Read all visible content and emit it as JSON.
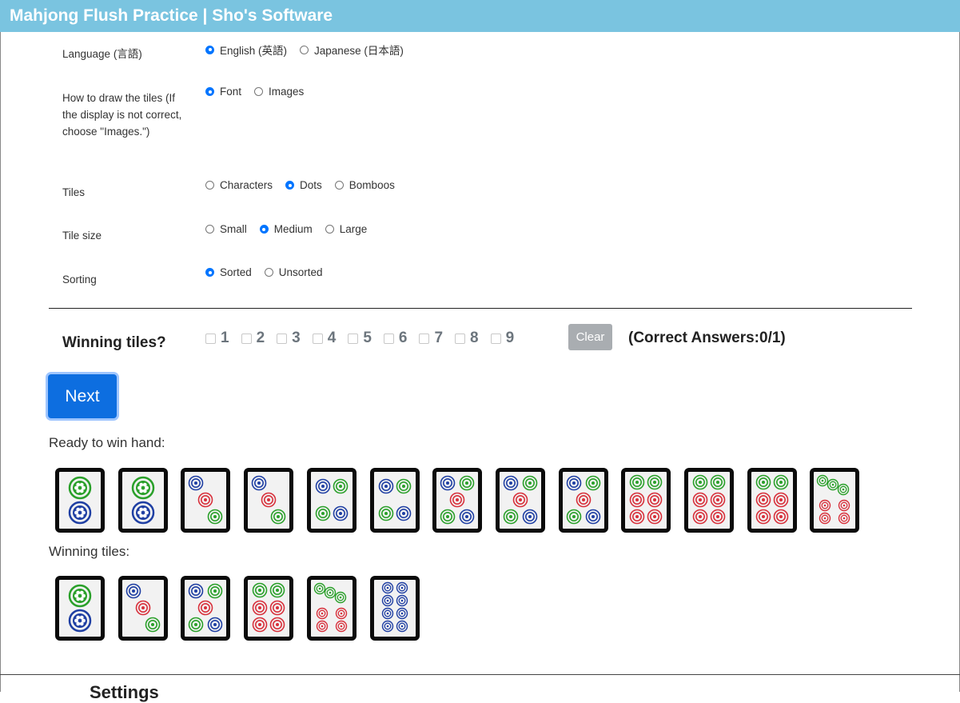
{
  "app": {
    "title": "Mahjong Flush Practice | Sho's Software"
  },
  "settings": {
    "language": {
      "label": "Language (言語)",
      "options": [
        "English (英語)",
        "Japanese (日本語)"
      ],
      "selected": 0
    },
    "draw": {
      "label": "How to draw the tiles (If the display is not correct, choose \"Images.\")",
      "options": [
        "Font",
        "Images"
      ],
      "selected": 0
    },
    "tiles": {
      "label": "Tiles",
      "options": [
        "Characters",
        "Dots",
        "Bomboos"
      ],
      "selected": 1
    },
    "size": {
      "label": "Tile size",
      "options": [
        "Small",
        "Medium",
        "Large"
      ],
      "selected": 1
    },
    "sorting": {
      "label": "Sorting",
      "options": [
        "Sorted",
        "Unsorted"
      ],
      "selected": 0
    }
  },
  "quiz": {
    "winning_label": "Winning tiles?",
    "checkbox_labels": [
      "1",
      "2",
      "3",
      "4",
      "5",
      "6",
      "7",
      "8",
      "9"
    ],
    "clear_label": "Clear",
    "correct_text": "(Correct Answers:0/1)",
    "next_label": "Next"
  },
  "hand": {
    "ready_label": "Ready to win hand:",
    "ready_tiles": [
      2,
      2,
      3,
      3,
      4,
      4,
      5,
      5,
      5,
      6,
      6,
      6,
      7
    ],
    "winning_label": "Winning tiles:",
    "winning_tiles": [
      2,
      3,
      5,
      6,
      7,
      8
    ]
  },
  "colors": {
    "blue": "#1f3fa3",
    "green": "#2aa02a",
    "red": "#d8303b",
    "titlebar": "#7ac4e0"
  },
  "footer": {
    "text": "Settings"
  }
}
